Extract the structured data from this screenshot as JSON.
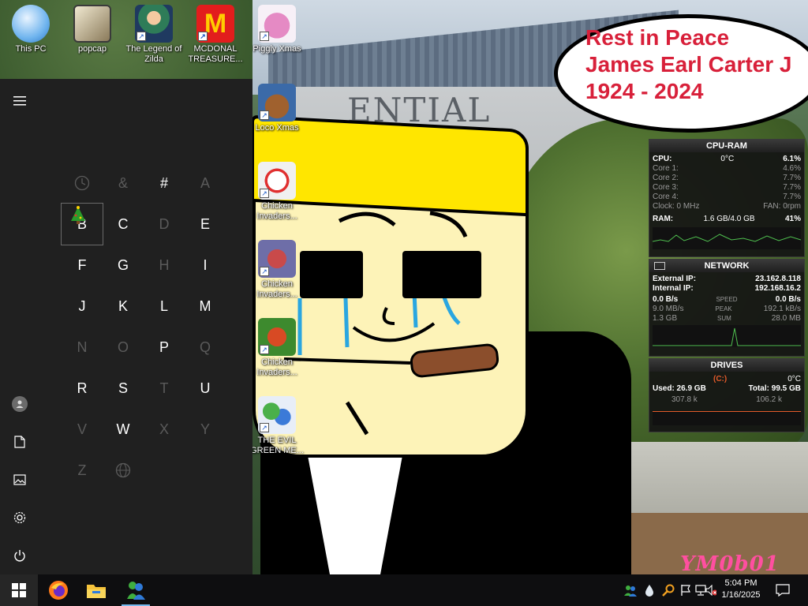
{
  "desktop": {
    "icons": [
      {
        "label": "This PC"
      },
      {
        "label": "popcap"
      },
      {
        "label": "The Legend of Zilda"
      },
      {
        "label": "MCDONAL TREASURE..."
      },
      {
        "label": "Piggly Xmas"
      },
      {
        "label": "Loco Xmas"
      },
      {
        "label": "Chicken Invaders..."
      },
      {
        "label": "Chicken Invaders..."
      },
      {
        "label": "Chicken Invaders..."
      },
      {
        "label": "THE EVIL GREEN ME..."
      }
    ],
    "wallpaper": {
      "building_text": "ENTIAL",
      "speech_bubble": [
        "Rest in Peace",
        "James Earl Carter J",
        "1924 - 2024"
      ],
      "watermark": "YM0b01"
    }
  },
  "start_menu": {
    "rail": {
      "expand": "menu-icon",
      "user": "user-icon",
      "documents": "document-icon",
      "pictures": "pictures-icon",
      "settings": "gear-icon",
      "power": "power-icon"
    },
    "jump_letters": [
      {
        "label": "",
        "icon": "clock-icon",
        "enabled": false
      },
      {
        "label": "&",
        "enabled": false
      },
      {
        "label": "#",
        "enabled": true
      },
      {
        "label": "A",
        "enabled": false
      },
      {
        "label": "B",
        "enabled": true,
        "selected": true
      },
      {
        "label": "C",
        "enabled": true
      },
      {
        "label": "D",
        "enabled": false
      },
      {
        "label": "E",
        "enabled": true
      },
      {
        "label": "F",
        "enabled": true
      },
      {
        "label": "G",
        "enabled": true
      },
      {
        "label": "H",
        "enabled": false
      },
      {
        "label": "I",
        "enabled": true
      },
      {
        "label": "J",
        "enabled": true
      },
      {
        "label": "K",
        "enabled": true
      },
      {
        "label": "L",
        "enabled": true
      },
      {
        "label": "M",
        "enabled": true
      },
      {
        "label": "N",
        "enabled": false
      },
      {
        "label": "O",
        "enabled": false
      },
      {
        "label": "P",
        "enabled": true
      },
      {
        "label": "Q",
        "enabled": false
      },
      {
        "label": "R",
        "enabled": true
      },
      {
        "label": "S",
        "enabled": true
      },
      {
        "label": "T",
        "enabled": false
      },
      {
        "label": "U",
        "enabled": true
      },
      {
        "label": "V",
        "enabled": false
      },
      {
        "label": "W",
        "enabled": true
      },
      {
        "label": "X",
        "enabled": false
      },
      {
        "label": "Y",
        "enabled": false
      },
      {
        "label": "Z",
        "enabled": false
      },
      {
        "label": "",
        "icon": "globe-icon",
        "enabled": false
      }
    ]
  },
  "gadgets": {
    "cpu_ram": {
      "title": "CPU-RAM",
      "cpu_label": "CPU:",
      "cpu_temp": "0°C",
      "cpu_pct": "6.1%",
      "cores": [
        {
          "label": "Core 1:",
          "value": "4.6%"
        },
        {
          "label": "Core 2:",
          "value": "7.7%"
        },
        {
          "label": "Core 3:",
          "value": "7.7%"
        },
        {
          "label": "Core 4:",
          "value": "7.7%"
        }
      ],
      "clock": "Clock: 0 MHz",
      "fan": "FAN: 0rpm",
      "ram_label": "RAM:",
      "ram_used": "1.6 GB/4.0 GB",
      "ram_pct": "41%"
    },
    "network": {
      "title": "NETWORK",
      "external_label": "External IP:",
      "external_ip": "23.162.8.118",
      "internal_label": "Internal IP:",
      "internal_ip": "192.168.16.2",
      "speed_left": "0.0 B/s",
      "speed_label": "SPEED",
      "speed_right": "0.0 B/s",
      "peak_left": "9.0 MB/s",
      "peak_label": "PEAK",
      "peak_right": "192.1 kB/s",
      "sum_left": "1.3 GB",
      "sum_label": "SUM",
      "sum_right": "28.0 MB"
    },
    "drives": {
      "title": "DRIVES",
      "drive": "(C:)",
      "temp": "0°C",
      "used": "Used: 26.9 GB",
      "total": "Total: 99.5 GB",
      "read": "307.8 k",
      "write": "106.2 k"
    }
  },
  "taskbar": {
    "start": "windows-logo-icon",
    "pinned": [
      "firefox-icon",
      "file-explorer-icon",
      "msn-messenger-icon"
    ],
    "tray_icons": [
      "people-icon",
      "drop-icon",
      "search-tool-icon",
      "flag-icon",
      "network-icon",
      "volume-muted-icon"
    ],
    "time": "5:04 PM",
    "date": "1/16/2025",
    "notifications": "notification-icon"
  },
  "colors": {
    "start_bg": "#202020",
    "taskbar_bg": "#0e0e10",
    "bubble_text": "#d8203a",
    "hat": "#ffe600",
    "watermark": "#ff4fa0"
  }
}
